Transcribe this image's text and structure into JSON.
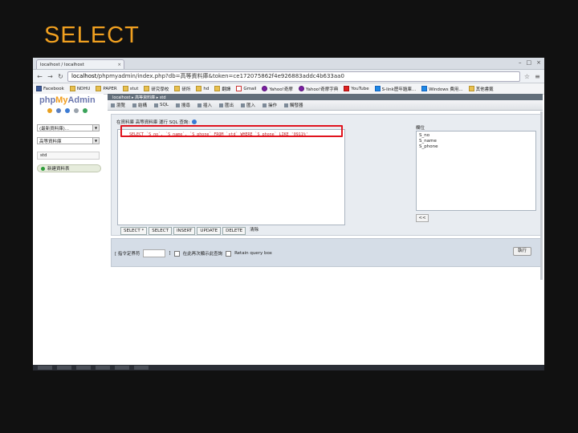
{
  "slide": {
    "title": "SELECT"
  },
  "browser": {
    "tab_title": "localhost / localhost",
    "url_host": "localhost",
    "url_path": "/phpmyadmin/index.php?db=高等資料庫&token=ce172075862f4e926883addc4b633aa0",
    "bookmarks": [
      {
        "icon": "facebook-icon",
        "label": "Facebook"
      },
      {
        "icon": "folder-icon",
        "label": "NDHU"
      },
      {
        "icon": "folder-icon",
        "label": "PAPER"
      },
      {
        "icon": "folder-icon",
        "label": "stut"
      },
      {
        "icon": "folder-icon",
        "label": "研究學校"
      },
      {
        "icon": "folder-icon",
        "label": "研所"
      },
      {
        "icon": "folder-icon",
        "label": "hd"
      },
      {
        "icon": "folder-icon",
        "label": "翻譯"
      },
      {
        "icon": "gmail-icon",
        "label": "Gmail"
      },
      {
        "icon": "yahoo-icon",
        "label": "Yahoo!奇摩"
      },
      {
        "icon": "yahoo-icon",
        "label": "Yahoo!奇摩字典"
      },
      {
        "icon": "youtube-icon",
        "label": "YouTube"
      },
      {
        "icon": "link-icon",
        "label": "S-link歷年題庫..."
      },
      {
        "icon": "windows-icon",
        "label": "Windows 費用..."
      },
      {
        "icon": "folder-icon",
        "label": "其他書籤"
      }
    ]
  },
  "pma": {
    "logo_php": "php",
    "logo_my": "My",
    "logo_admin": "Admin",
    "db_select": "(最新資料庫)...",
    "db_select2": "高等資料庫",
    "table_item": "std",
    "new_table": "新建資料表",
    "breadcrumb": "localhost ▸ 高等資料庫 ▸ std",
    "menu": [
      "瀏覽",
      "結構",
      "SQL",
      "搜尋",
      "插入",
      "匯出",
      "匯入",
      "操作",
      "觸發器"
    ],
    "legend": "在資料庫 高等資料庫 運行 SQL 查詢:",
    "line_number": "1",
    "sql_query": "SELECT `S_no`, `S_name`, `S_phone` FROM `std` WHERE `S_phone` LIKE '0911%'",
    "fields_label": "欄位",
    "fields": [
      "S_no",
      "S_name",
      "S_phone"
    ],
    "insert_btn": "<<",
    "buttons": [
      "SELECT *",
      "SELECT",
      "INSERT",
      "UPDATE",
      "DELETE"
    ],
    "clear_btn": "清除",
    "delimiter_label": "[ 指令定界符",
    "delimiter_close": "]",
    "show_again_label": "在此再次顯示此查詢",
    "retain_box_label": "Retain query box",
    "go_btn": "執行"
  },
  "colors": {
    "slide_title": "#f0a020",
    "highlight": "#e0141e"
  }
}
